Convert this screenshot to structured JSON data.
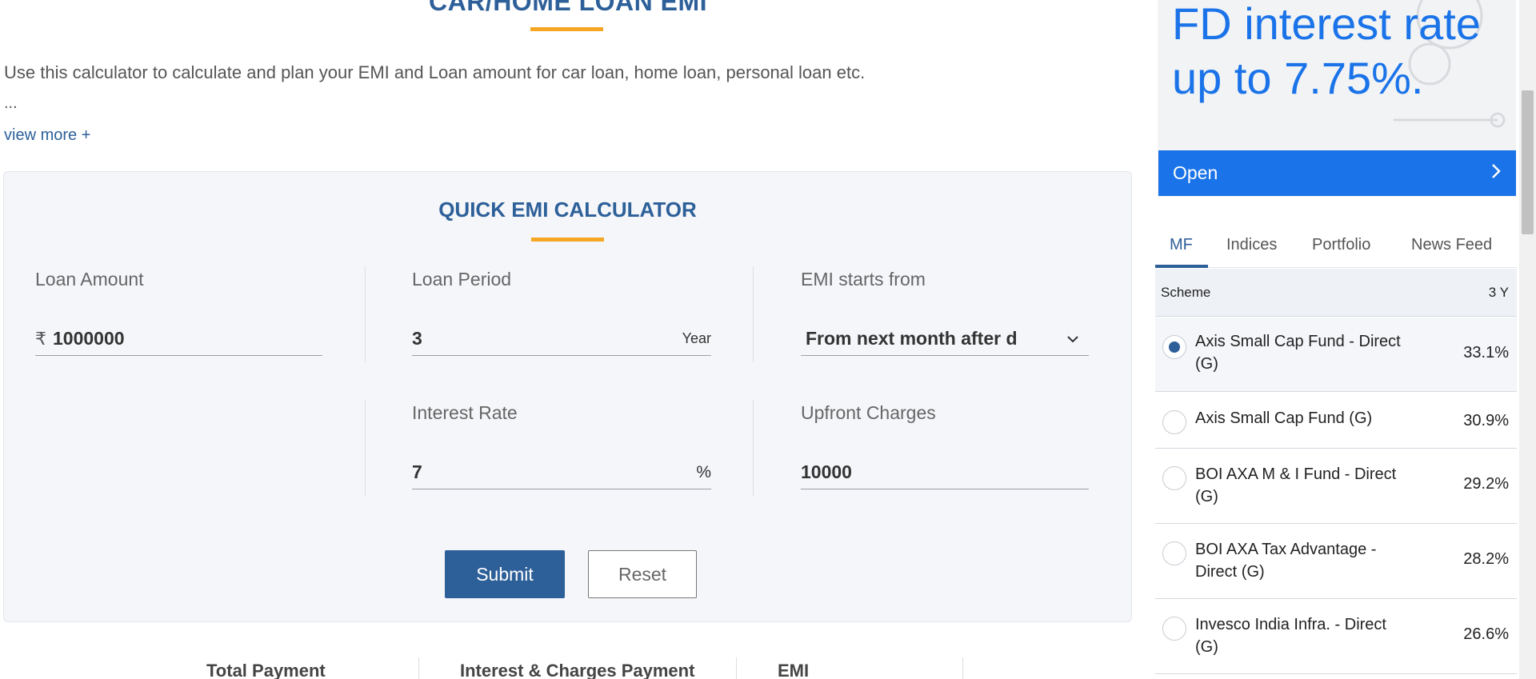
{
  "page": {
    "heading": "CAR/HOME LOAN EMI",
    "intro": "Use this calculator to calculate and plan your EMI and Loan amount for car loan, home loan, personal loan etc.",
    "ellipsis": "...",
    "view_more": "view more +"
  },
  "calculator": {
    "title": "QUICK EMI CALCULATOR",
    "loan_amount": {
      "label": "Loan Amount",
      "currency": "₹",
      "value": "1000000"
    },
    "loan_period": {
      "label": "Loan Period",
      "value": "3",
      "unit": "Year"
    },
    "emi_starts": {
      "label": "EMI starts from",
      "value": "From next month after d"
    },
    "interest_rate": {
      "label": "Interest Rate",
      "value": "7",
      "unit": "%"
    },
    "upfront_charges": {
      "label": "Upfront Charges",
      "value": "10000"
    },
    "submit_label": "Submit",
    "reset_label": "Reset"
  },
  "results": {
    "labels": [
      "Total Payment",
      "Interest & Charges Payment",
      "EMI"
    ]
  },
  "ad": {
    "text": "FD interest rate up to 7.75%.",
    "open_label": "Open",
    "open_arrow": ">"
  },
  "tabs": [
    {
      "label": "MF",
      "active": true
    },
    {
      "label": "Indices",
      "active": false
    },
    {
      "label": "Portfolio",
      "active": false
    },
    {
      "label": "News Feed",
      "active": false
    }
  ],
  "mf_table": {
    "columns": [
      "Scheme",
      "3 Y"
    ],
    "rows": [
      {
        "name": "Axis Small Cap Fund - Direct (G)",
        "return": "33.1%",
        "selected": true
      },
      {
        "name": "Axis Small Cap Fund (G)",
        "return": "30.9%",
        "selected": false
      },
      {
        "name": "BOI AXA M & I Fund - Direct (G)",
        "return": "29.2%",
        "selected": false
      },
      {
        "name": "BOI AXA Tax Advantage - Direct (G)",
        "return": "28.2%",
        "selected": false
      },
      {
        "name": "Invesco India Infra. - Direct (G)",
        "return": "26.6%",
        "selected": false
      }
    ]
  },
  "colors": {
    "brand_blue": "#2d5f99",
    "accent_orange": "#f5a623",
    "ad_blue": "#1a73e8"
  }
}
